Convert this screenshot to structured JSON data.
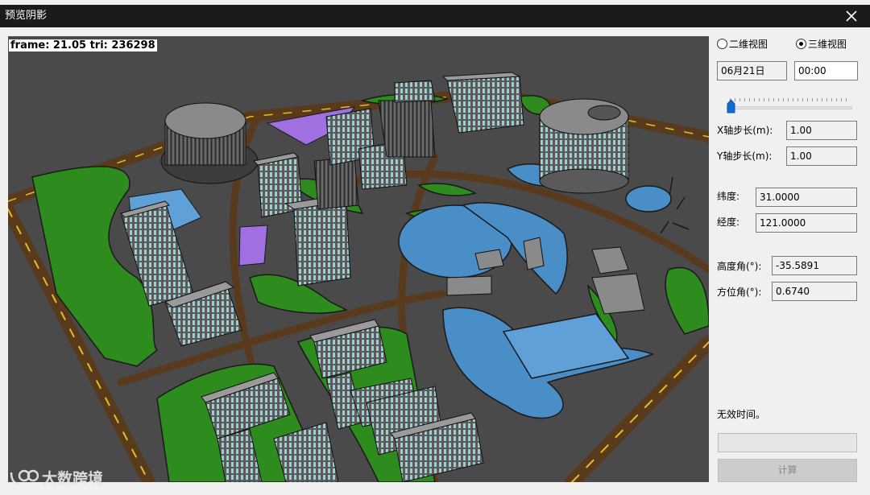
{
  "window": {
    "title": "预览阴影"
  },
  "viewport": {
    "frame_stats": "frame: 21.05 tri: 236298"
  },
  "watermark": {
    "text": "大数跨境"
  },
  "panel": {
    "view_2d": "二维视图",
    "view_3d": "三维视图",
    "selected_view": "三维视图",
    "date": "06月21日",
    "time": "00:00",
    "time_slider_value": 0,
    "x_step_label": "X轴步长(m):",
    "x_step": "1.00",
    "y_step_label": "Y轴步长(m):",
    "y_step": "1.00",
    "latitude_label": "纬度:",
    "latitude": "31.0000",
    "longitude_label": "经度:",
    "longitude": "121.0000",
    "altitude_label": "高度角(°):",
    "altitude": "-35.5891",
    "azimuth_label": "方位角(°):",
    "azimuth": "0.6740",
    "status": "无效时间。",
    "calc_button": "计算"
  },
  "colors": {
    "grass": "#2e8b1e",
    "road": "#5a3a1c",
    "road_line": "#e0c020",
    "water": "#4a8ec8",
    "building": "#7e7e7e",
    "window": "#8fd3d8",
    "highlight": "#a070e0",
    "ground": "#4a4a4a"
  }
}
